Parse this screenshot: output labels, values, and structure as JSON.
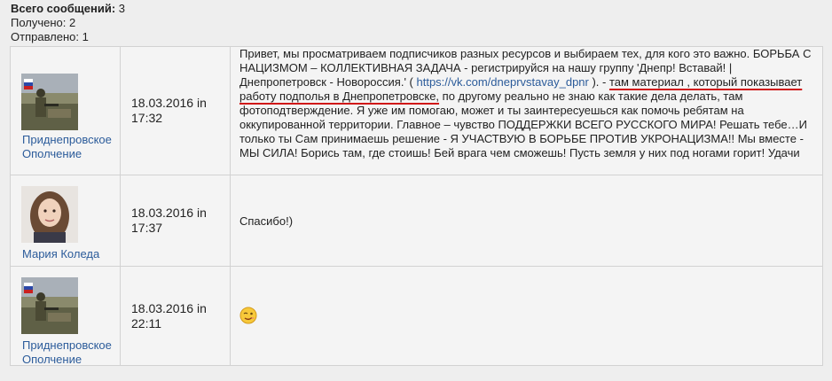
{
  "summary": {
    "total_label": "Всего сообщений:",
    "total_value": "3",
    "received": "Получено: 2",
    "sent": "Отправлено: 1"
  },
  "messages": [
    {
      "author": "Приднепровское Ополчение",
      "avatar_icon": "flag-soldier-avatar-icon",
      "date": "18.03.2016 in 17:32",
      "text_part1": "Привет, мы просматриваем подписчиков разных ресурсов и выбираем тех, для кого это важно. БОРЬБА С НАЦИЗМОМ – КОЛЛЕКТИВНАЯ ЗАДАЧА - регистрируйся на нашу группу 'Днепр! Вставай! | Днепропетровск - Новороссия.' ( ",
      "link": "https://vk.com/dneprvstavay_dpnr",
      "text_part2": " ). - ",
      "highlight": "там материал , который показывает работу подполья в Днепропетровске,",
      "text_part3": " по другому реально не знаю как такие дела делать, там фотоподтверждение. Я уже им помогаю, может и ты заинтересуешься как помочь ребятам на оккупированной территории. Главное – чувство ПОДДЕРЖКИ ВСЕГО РУССКОГО МИРА! Решать тебе…И только ты Сам принимаешь решение - Я УЧАСТВУЮ В БОРЬБЕ ПРОТИВ УКРОНАЦИЗМА!! Мы вместе - МЫ СИЛА! Борись там, где стоишь! Бей врага чем сможешь! Пусть земля у них под ногами горит! Удачи"
    },
    {
      "author": "Мария Коледа",
      "avatar_icon": "woman-portrait-avatar-icon",
      "date": "18.03.2016 in 17:37",
      "text": "Спасибо!)"
    },
    {
      "author": "Приднепровское Ополчение",
      "avatar_icon": "flag-soldier-avatar-icon",
      "date": "18.03.2016 in 22:11",
      "emoji": "wink-smiley-icon"
    }
  ],
  "colors": {
    "background": "#eeeeee",
    "link": "#2b5b9a",
    "highlight_underline": "#d01818"
  }
}
